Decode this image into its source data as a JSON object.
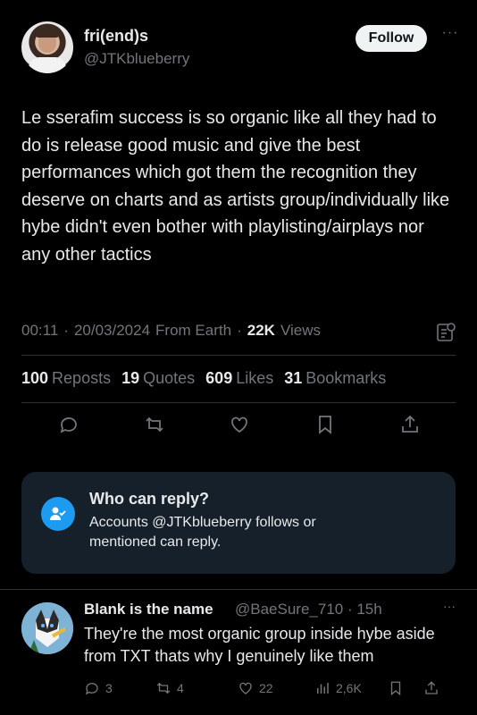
{
  "tweet": {
    "author_name": "fri(end)s",
    "author_handle": "@JTKblueberry",
    "follow_label": "Follow",
    "more_label": "···",
    "text": "Le sserafim success is so organic like all they had to do is release good music and give the best performances which got them the recognition they deserve on charts and as artists group/individually like hybe didn't even bother with playlisting/airplays nor any other tactics",
    "time": "00:11",
    "date": "20/03/2024",
    "source": "From Earth",
    "sep": "·",
    "views_count": "22K",
    "views_label": "Views"
  },
  "stats": {
    "reposts_count": "100",
    "reposts_label": "Reposts",
    "quotes_count": "19",
    "quotes_label": "Quotes",
    "likes_count": "609",
    "likes_label": "Likes",
    "bookmarks_count": "31",
    "bookmarks_label": "Bookmarks"
  },
  "icons": {
    "actions": [
      "reply-icon",
      "repost-icon",
      "like-icon",
      "bookmark-icon",
      "share-icon"
    ],
    "analytics": "analytics-icon"
  },
  "reply_settings": {
    "title": "Who can reply?",
    "description": "Accounts @JTKblueberry follows or mentioned can reply.",
    "icon": "people-check-icon"
  },
  "reply": {
    "author_name": "Blank is the name",
    "author_handle": "@BaeSure_710",
    "time": "· 15h",
    "more_label": "···",
    "text": "They're the most organic group inside hybe aside from TXT thats why I genuinely like them",
    "replies": "3",
    "reposts": "4",
    "likes": "22",
    "views": "2,6K"
  },
  "colors": {
    "background": "#000000",
    "text": "#e7e9ea",
    "muted": "#71767b",
    "accent": "#1d9bf0",
    "card": "#16202a"
  }
}
